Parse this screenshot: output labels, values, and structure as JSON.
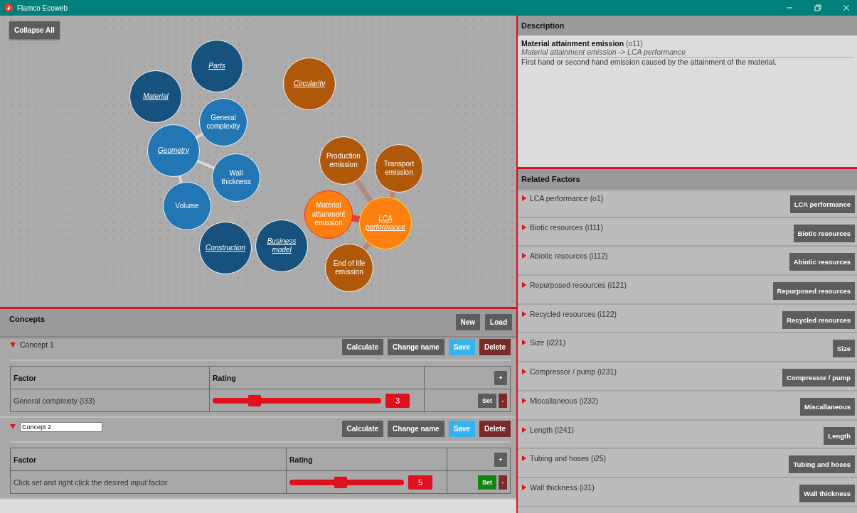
{
  "window": {
    "title": "Flamco Ecoweb"
  },
  "graph": {
    "collapse_button": "Collapse All",
    "nodes": [
      {
        "label": "Parts",
        "color": "#17527e",
        "link": true,
        "selected": false,
        "highlighted": false
      },
      {
        "label": "Material",
        "color": "#17527e",
        "link": true,
        "selected": false,
        "highlighted": false
      },
      {
        "label": "Circularity",
        "color": "#b0580a",
        "link": true,
        "selected": false,
        "highlighted": false
      },
      {
        "label": "General complexity",
        "color": "#2176b3",
        "link": false,
        "selected": false,
        "highlighted": false
      },
      {
        "label": "Geometry",
        "color": "#2176b3",
        "link": true,
        "selected": false,
        "highlighted": false
      },
      {
        "label": "Wall thickness",
        "color": "#2176b3",
        "link": false,
        "selected": false,
        "highlighted": false
      },
      {
        "label": "Volume",
        "color": "#2176b3",
        "link": false,
        "selected": false,
        "highlighted": false
      },
      {
        "label": "Construction",
        "color": "#17527e",
        "link": true,
        "selected": false,
        "highlighted": false
      },
      {
        "label": "Business model",
        "color": "#17527e",
        "link": true,
        "selected": false,
        "highlighted": false
      },
      {
        "label": "Production emission",
        "color": "#b0580a",
        "link": false,
        "selected": false,
        "highlighted": false
      },
      {
        "label": "Transport emission",
        "color": "#b0580a",
        "link": false,
        "selected": false,
        "highlighted": false
      },
      {
        "label": "Material attainment emission",
        "color": "#fd7f0f",
        "link": false,
        "selected": true,
        "highlighted": false
      },
      {
        "label": "LCA performance",
        "color": "#fd7f0f",
        "link": true,
        "selected": false,
        "highlighted": true
      },
      {
        "label": "End of life emission",
        "color": "#b0580a",
        "link": false,
        "selected": false,
        "highlighted": false
      }
    ]
  },
  "concepts": {
    "title": "Concepts",
    "buttons": [
      "New",
      "Load"
    ],
    "items": [
      {
        "name": "Concept 1",
        "editing": false,
        "expanded": true,
        "actions": [
          "Calculate",
          "Change name",
          "Save",
          "Delete"
        ],
        "columns": [
          "Factor",
          "Rating"
        ],
        "add": "+",
        "rows": [
          {
            "factor": "General complexity (I33)",
            "level": 0.25,
            "value": "3",
            "set": "Set",
            "set_active": false,
            "remove": "-"
          }
        ]
      },
      {
        "name": "Concept 2",
        "editing": true,
        "expanded": true,
        "actions": [
          "Calculate",
          "Change name",
          "Save",
          "Delete"
        ],
        "columns": [
          "Factor",
          "Rating"
        ],
        "add": "+",
        "rows": [
          {
            "factor": "Click set and right click the desired input factor",
            "level": 0.45,
            "value": "5",
            "set": "Set",
            "set_active": true,
            "remove": "-"
          }
        ]
      }
    ]
  },
  "description": {
    "title": "Description",
    "name": "Material attainment emission",
    "code": "(o11)",
    "path": "Material attainment emission -> LCA performance",
    "text": "First hand or second hand emission caused by the attainment of the material."
  },
  "related": {
    "title": "Related Factors",
    "items": [
      {
        "label": "LCA performance (o1)",
        "button": "LCA performance",
        "expanded": false
      },
      {
        "label": "Biotic resources (i111)",
        "button": "Biotic resources",
        "expanded": false
      },
      {
        "label": "Abiotic resources (i112)",
        "button": "Abiotic resources",
        "expanded": false
      },
      {
        "label": "Repurposed resources (i121)",
        "button": "Repurposed resources",
        "expanded": false
      },
      {
        "label": "Recycled resources (i122)",
        "button": "Recycled resources",
        "expanded": false
      },
      {
        "label": "Size (i221)",
        "button": "Size",
        "expanded": false
      },
      {
        "label": "Compressor / pump (i231)",
        "button": "Compressor / pump",
        "expanded": false
      },
      {
        "label": "Miscallaneous (i232)",
        "button": "Miscallaneous",
        "expanded": false
      },
      {
        "label": "Length (i241)",
        "button": "Length",
        "expanded": false
      },
      {
        "label": "Tubing and hoses (i25)",
        "button": "Tubing and hoses",
        "expanded": false
      },
      {
        "label": "Wall thickness (i31)",
        "button": "Wall thickness",
        "expanded": false
      }
    ]
  }
}
